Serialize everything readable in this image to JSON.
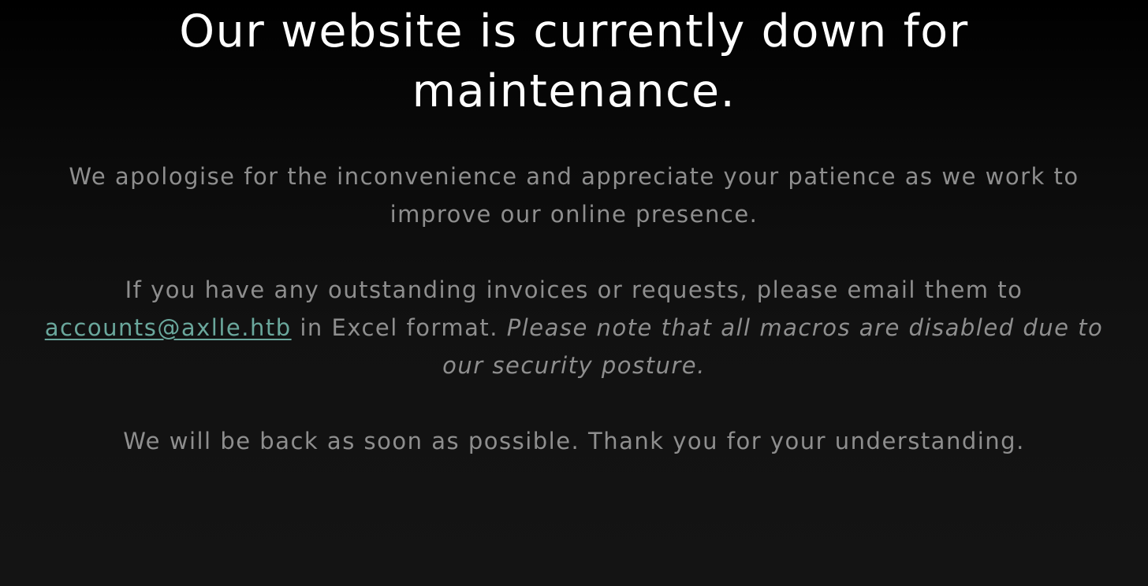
{
  "heading": {
    "line1": "Our website is currently down for",
    "line2": "maintenance."
  },
  "apology": {
    "line1": "We apologise for the inconvenience and appreciate your patience as we work to",
    "line2": "improve our online presence."
  },
  "invoice": {
    "line1": "If you have any outstanding invoices or requests, please email them to",
    "email": "accounts@axlle.htb",
    "format_text": " in Excel format. ",
    "note_part1": "Please note that all macros are disabled due to",
    "note_part2": "our security posture."
  },
  "closing": "We will be back as soon as possible. Thank you for your understanding.",
  "colors": {
    "background": "#111111",
    "heading": "#ffffff",
    "body_text": "#8e8e8e",
    "link": "#6aa79c"
  }
}
